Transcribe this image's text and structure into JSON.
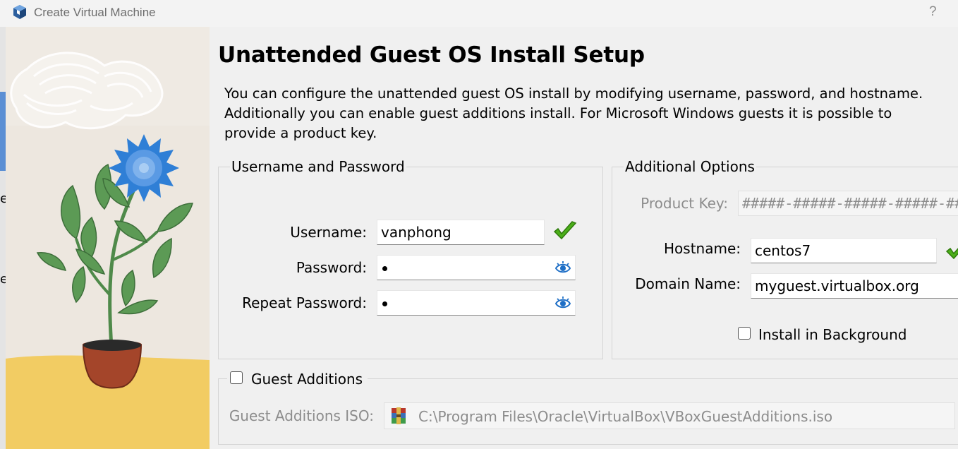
{
  "window": {
    "title": "Create Virtual Machine",
    "help": "?"
  },
  "left_edge_chars": [
    "e",
    "e"
  ],
  "page": {
    "title": "Unattended Guest OS Install Setup",
    "description": "You can configure the unattended guest OS install by modifying username, password, and hostname. Additionally you can enable guest additions install. For Microsoft Windows guests it is possible to provide a product key."
  },
  "credentials": {
    "group_title": "Username and Password",
    "username_label": "Username:",
    "username_value": "vanphong",
    "password_label": "Password:",
    "repeat_password_label": "Repeat Password:"
  },
  "options": {
    "group_title": "Additional Options",
    "product_key_label": "Product Key:",
    "product_key_value": "#####-#####-#####-#####-#####",
    "hostname_label": "Hostname:",
    "hostname_value": "centos7",
    "domain_label": "Domain Name:",
    "domain_value": "myguest.virtualbox.org",
    "install_background_label": "Install in Background",
    "install_background_checked": false
  },
  "guest_additions": {
    "label": "Guest Additions",
    "checked": false,
    "iso_label": "Guest Additions ISO:",
    "iso_path": "C:\\Program Files\\Oracle\\VirtualBox\\VBoxGuestAdditions.iso"
  },
  "icons": {
    "app": "virtualbox-cube-icon",
    "valid": "green-checkmark-icon",
    "reveal": "eye-icon",
    "iso_file": "archive-file-icon"
  },
  "colors": {
    "valid_green": "#4caf1a",
    "eye_blue": "#1f6fc6",
    "sand": "#f2cc63",
    "flower_blue": "#2f7fd6"
  }
}
